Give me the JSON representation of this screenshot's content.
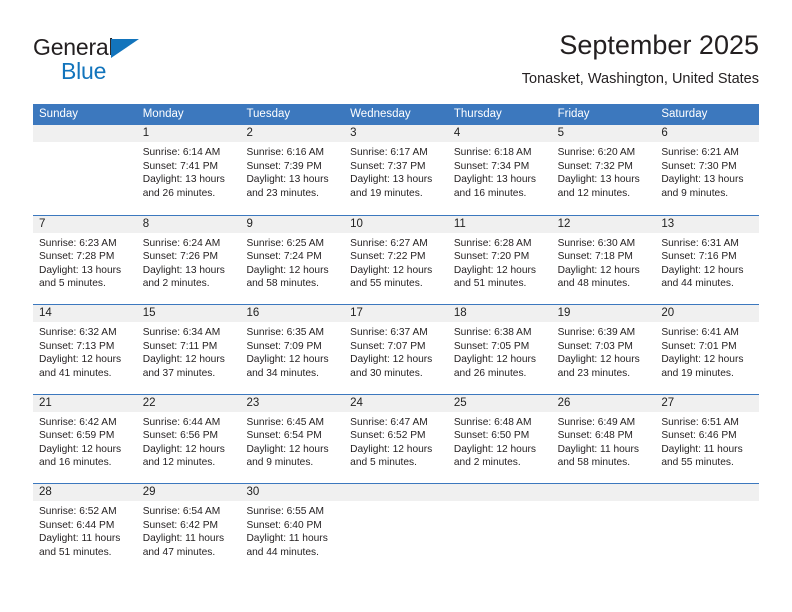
{
  "logo": {
    "word1": "General",
    "word2": "Blue",
    "triangle_color": "#1274bc",
    "icon": "triangle-logo-icon"
  },
  "header": {
    "title": "September 2025",
    "subtitle": "Tonasket, Washington, United States"
  },
  "theme": {
    "header_blue": "#3c78be",
    "day_band_gray": "#f0f0f0",
    "text": "#231f20"
  },
  "calendar": {
    "day_headers": [
      "Sunday",
      "Monday",
      "Tuesday",
      "Wednesday",
      "Thursday",
      "Friday",
      "Saturday"
    ],
    "weeks": [
      [
        {
          "day": "",
          "empty": true,
          "sunrise": "",
          "sunset": "",
          "daylight_line1": "",
          "daylight_line2": ""
        },
        {
          "day": "1",
          "sunrise": "Sunrise: 6:14 AM",
          "sunset": "Sunset: 7:41 PM",
          "daylight_line1": "Daylight: 13 hours",
          "daylight_line2": "and 26 minutes."
        },
        {
          "day": "2",
          "sunrise": "Sunrise: 6:16 AM",
          "sunset": "Sunset: 7:39 PM",
          "daylight_line1": "Daylight: 13 hours",
          "daylight_line2": "and 23 minutes."
        },
        {
          "day": "3",
          "sunrise": "Sunrise: 6:17 AM",
          "sunset": "Sunset: 7:37 PM",
          "daylight_line1": "Daylight: 13 hours",
          "daylight_line2": "and 19 minutes."
        },
        {
          "day": "4",
          "sunrise": "Sunrise: 6:18 AM",
          "sunset": "Sunset: 7:34 PM",
          "daylight_line1": "Daylight: 13 hours",
          "daylight_line2": "and 16 minutes."
        },
        {
          "day": "5",
          "sunrise": "Sunrise: 6:20 AM",
          "sunset": "Sunset: 7:32 PM",
          "daylight_line1": "Daylight: 13 hours",
          "daylight_line2": "and 12 minutes."
        },
        {
          "day": "6",
          "sunrise": "Sunrise: 6:21 AM",
          "sunset": "Sunset: 7:30 PM",
          "daylight_line1": "Daylight: 13 hours",
          "daylight_line2": "and 9 minutes."
        }
      ],
      [
        {
          "day": "7",
          "sunrise": "Sunrise: 6:23 AM",
          "sunset": "Sunset: 7:28 PM",
          "daylight_line1": "Daylight: 13 hours",
          "daylight_line2": "and 5 minutes."
        },
        {
          "day": "8",
          "sunrise": "Sunrise: 6:24 AM",
          "sunset": "Sunset: 7:26 PM",
          "daylight_line1": "Daylight: 13 hours",
          "daylight_line2": "and 2 minutes."
        },
        {
          "day": "9",
          "sunrise": "Sunrise: 6:25 AM",
          "sunset": "Sunset: 7:24 PM",
          "daylight_line1": "Daylight: 12 hours",
          "daylight_line2": "and 58 minutes."
        },
        {
          "day": "10",
          "sunrise": "Sunrise: 6:27 AM",
          "sunset": "Sunset: 7:22 PM",
          "daylight_line1": "Daylight: 12 hours",
          "daylight_line2": "and 55 minutes."
        },
        {
          "day": "11",
          "sunrise": "Sunrise: 6:28 AM",
          "sunset": "Sunset: 7:20 PM",
          "daylight_line1": "Daylight: 12 hours",
          "daylight_line2": "and 51 minutes."
        },
        {
          "day": "12",
          "sunrise": "Sunrise: 6:30 AM",
          "sunset": "Sunset: 7:18 PM",
          "daylight_line1": "Daylight: 12 hours",
          "daylight_line2": "and 48 minutes."
        },
        {
          "day": "13",
          "sunrise": "Sunrise: 6:31 AM",
          "sunset": "Sunset: 7:16 PM",
          "daylight_line1": "Daylight: 12 hours",
          "daylight_line2": "and 44 minutes."
        }
      ],
      [
        {
          "day": "14",
          "sunrise": "Sunrise: 6:32 AM",
          "sunset": "Sunset: 7:13 PM",
          "daylight_line1": "Daylight: 12 hours",
          "daylight_line2": "and 41 minutes."
        },
        {
          "day": "15",
          "sunrise": "Sunrise: 6:34 AM",
          "sunset": "Sunset: 7:11 PM",
          "daylight_line1": "Daylight: 12 hours",
          "daylight_line2": "and 37 minutes."
        },
        {
          "day": "16",
          "sunrise": "Sunrise: 6:35 AM",
          "sunset": "Sunset: 7:09 PM",
          "daylight_line1": "Daylight: 12 hours",
          "daylight_line2": "and 34 minutes."
        },
        {
          "day": "17",
          "sunrise": "Sunrise: 6:37 AM",
          "sunset": "Sunset: 7:07 PM",
          "daylight_line1": "Daylight: 12 hours",
          "daylight_line2": "and 30 minutes."
        },
        {
          "day": "18",
          "sunrise": "Sunrise: 6:38 AM",
          "sunset": "Sunset: 7:05 PM",
          "daylight_line1": "Daylight: 12 hours",
          "daylight_line2": "and 26 minutes."
        },
        {
          "day": "19",
          "sunrise": "Sunrise: 6:39 AM",
          "sunset": "Sunset: 7:03 PM",
          "daylight_line1": "Daylight: 12 hours",
          "daylight_line2": "and 23 minutes."
        },
        {
          "day": "20",
          "sunrise": "Sunrise: 6:41 AM",
          "sunset": "Sunset: 7:01 PM",
          "daylight_line1": "Daylight: 12 hours",
          "daylight_line2": "and 19 minutes."
        }
      ],
      [
        {
          "day": "21",
          "sunrise": "Sunrise: 6:42 AM",
          "sunset": "Sunset: 6:59 PM",
          "daylight_line1": "Daylight: 12 hours",
          "daylight_line2": "and 16 minutes."
        },
        {
          "day": "22",
          "sunrise": "Sunrise: 6:44 AM",
          "sunset": "Sunset: 6:56 PM",
          "daylight_line1": "Daylight: 12 hours",
          "daylight_line2": "and 12 minutes."
        },
        {
          "day": "23",
          "sunrise": "Sunrise: 6:45 AM",
          "sunset": "Sunset: 6:54 PM",
          "daylight_line1": "Daylight: 12 hours",
          "daylight_line2": "and 9 minutes."
        },
        {
          "day": "24",
          "sunrise": "Sunrise: 6:47 AM",
          "sunset": "Sunset: 6:52 PM",
          "daylight_line1": "Daylight: 12 hours",
          "daylight_line2": "and 5 minutes."
        },
        {
          "day": "25",
          "sunrise": "Sunrise: 6:48 AM",
          "sunset": "Sunset: 6:50 PM",
          "daylight_line1": "Daylight: 12 hours",
          "daylight_line2": "and 2 minutes."
        },
        {
          "day": "26",
          "sunrise": "Sunrise: 6:49 AM",
          "sunset": "Sunset: 6:48 PM",
          "daylight_line1": "Daylight: 11 hours",
          "daylight_line2": "and 58 minutes."
        },
        {
          "day": "27",
          "sunrise": "Sunrise: 6:51 AM",
          "sunset": "Sunset: 6:46 PM",
          "daylight_line1": "Daylight: 11 hours",
          "daylight_line2": "and 55 minutes."
        }
      ],
      [
        {
          "day": "28",
          "sunrise": "Sunrise: 6:52 AM",
          "sunset": "Sunset: 6:44 PM",
          "daylight_line1": "Daylight: 11 hours",
          "daylight_line2": "and 51 minutes."
        },
        {
          "day": "29",
          "sunrise": "Sunrise: 6:54 AM",
          "sunset": "Sunset: 6:42 PM",
          "daylight_line1": "Daylight: 11 hours",
          "daylight_line2": "and 47 minutes."
        },
        {
          "day": "30",
          "sunrise": "Sunrise: 6:55 AM",
          "sunset": "Sunset: 6:40 PM",
          "daylight_line1": "Daylight: 11 hours",
          "daylight_line2": "and 44 minutes."
        },
        {
          "day": "",
          "empty": true,
          "sunrise": "",
          "sunset": "",
          "daylight_line1": "",
          "daylight_line2": ""
        },
        {
          "day": "",
          "empty": true,
          "sunrise": "",
          "sunset": "",
          "daylight_line1": "",
          "daylight_line2": ""
        },
        {
          "day": "",
          "empty": true,
          "sunrise": "",
          "sunset": "",
          "daylight_line1": "",
          "daylight_line2": ""
        },
        {
          "day": "",
          "empty": true,
          "sunrise": "",
          "sunset": "",
          "daylight_line1": "",
          "daylight_line2": ""
        }
      ]
    ]
  }
}
